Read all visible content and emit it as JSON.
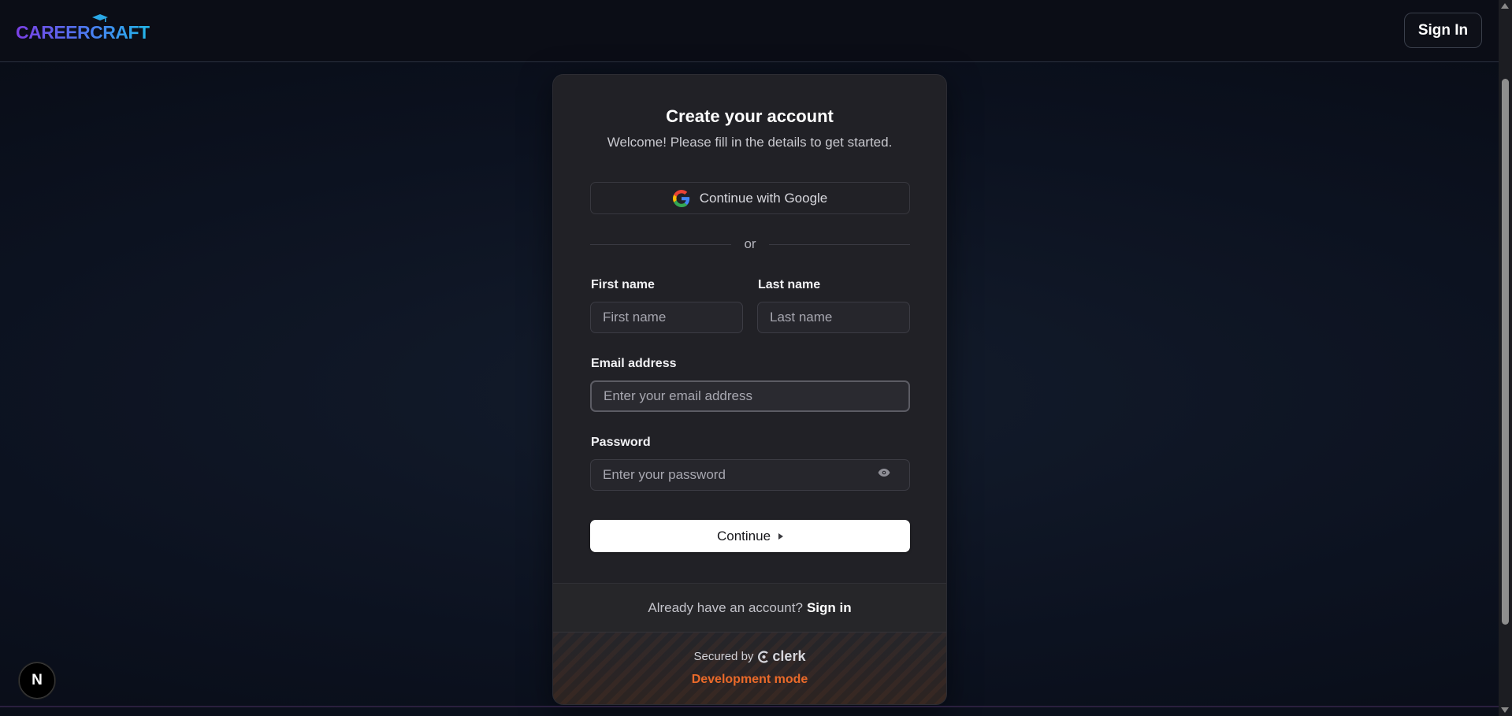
{
  "header": {
    "logo_text": "CAREERCRAFT",
    "sign_in_label": "Sign In"
  },
  "card": {
    "title": "Create your account",
    "subtitle": "Welcome! Please fill in the details to get started.",
    "google_button_label": "Continue with Google",
    "divider_text": "or",
    "first_name": {
      "label": "First name",
      "placeholder": "First name",
      "value": ""
    },
    "last_name": {
      "label": "Last name",
      "placeholder": "Last name",
      "value": ""
    },
    "email": {
      "label": "Email address",
      "placeholder": "Enter your email address",
      "value": ""
    },
    "password": {
      "label": "Password",
      "placeholder": "Enter your password",
      "value": ""
    },
    "continue_label": "Continue",
    "footer": {
      "account_prompt": "Already have an account?",
      "sign_in_link": "Sign in",
      "secured_by": "Secured by",
      "clerk_brand": "clerk",
      "dev_mode": "Development mode"
    }
  },
  "badge": {
    "letter": "N"
  },
  "colors": {
    "accent_orange": "#ea6a2a",
    "logo_gradient_start": "#7b3fe4",
    "logo_gradient_end": "#22b6e8",
    "card_bg": "#212126"
  }
}
